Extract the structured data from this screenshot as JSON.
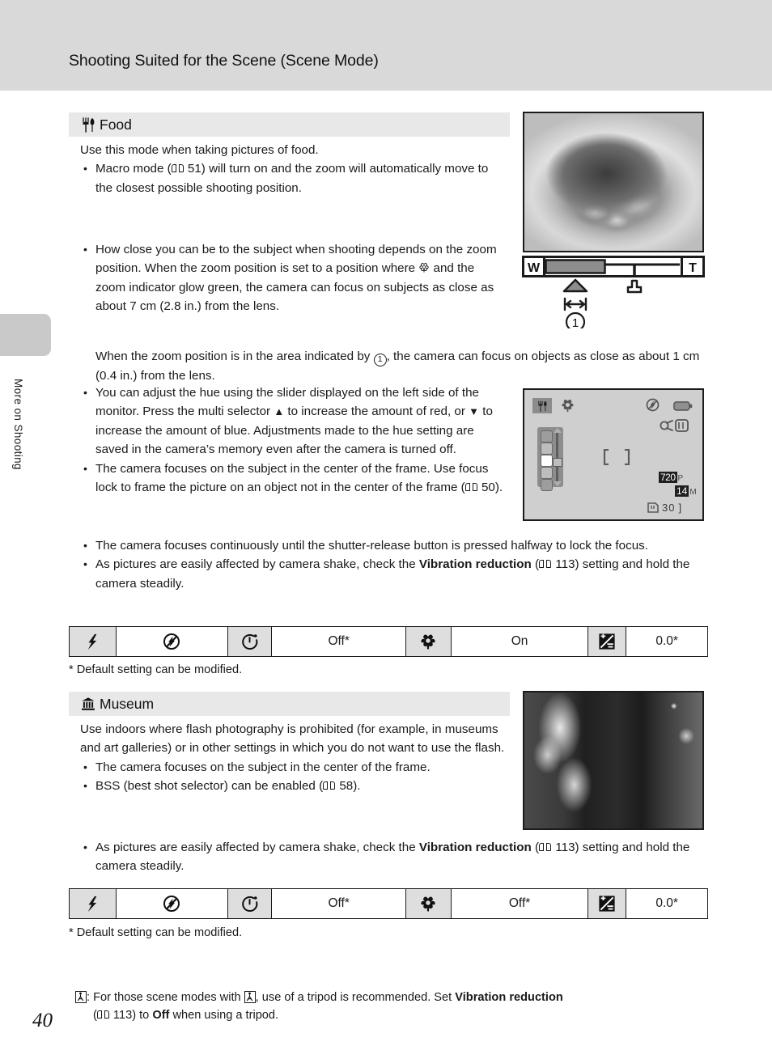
{
  "header": {
    "title": "Shooting Suited for the Scene (Scene Mode)"
  },
  "side_tab": {
    "label": "More on Shooting"
  },
  "page_number": "40",
  "sections": [
    {
      "id": "food",
      "icon": "cutlery-icon",
      "title": "Food",
      "intro": "Use this mode when taking pictures of food.",
      "bullets": [
        {
          "parts": [
            {
              "t": "text",
              "v": "Macro mode ("
            },
            {
              "t": "book",
              "v": ""
            },
            {
              "t": "text",
              "v": " 51) will turn on and the zoom will automatically move to the closest possible shooting position."
            }
          ]
        },
        {
          "parts": [
            {
              "t": "text",
              "v": "How close you can be to the subject when shooting depends on the zoom position. When the zoom position is set to a position where "
            },
            {
              "t": "macro",
              "v": ""
            },
            {
              "t": "text",
              "v": " and the zoom indicator glow green, the camera can focus on subjects as close as about 7 cm (2.8 in.) from the lens."
            }
          ],
          "continuation": [
            {
              "t": "text",
              "v": "When the zoom position is in the area indicated by "
            },
            {
              "t": "circ1",
              "v": "1"
            },
            {
              "t": "text",
              "v": ", the camera can focus on objects as close as about 1 cm (0.4 in.) from the lens."
            }
          ]
        },
        {
          "parts": [
            {
              "t": "text",
              "v": "You can adjust the hue using the slider displayed on the left side of the monitor. Press the multi selector "
            },
            {
              "t": "arrow-up",
              "v": "▲"
            },
            {
              "t": "text",
              "v": " to increase the amount of red, or "
            },
            {
              "t": "arrow-down",
              "v": "▼"
            },
            {
              "t": "text",
              "v": " to increase the amount of blue. Adjustments made to the hue setting are saved in the camera’s memory even after the camera is turned off."
            }
          ]
        },
        {
          "parts": [
            {
              "t": "text",
              "v": "The camera focuses on the subject in the center of the frame. Use focus lock to frame the picture on an object not in the center of the frame ("
            },
            {
              "t": "book",
              "v": ""
            },
            {
              "t": "text",
              "v": " 50)."
            }
          ]
        },
        {
          "parts": [
            {
              "t": "text",
              "v": "The camera focuses continuously until the shutter-release button is pressed halfway to lock the focus."
            }
          ]
        },
        {
          "parts": [
            {
              "t": "text",
              "v": "As pictures are easily affected by camera shake, check the "
            },
            {
              "t": "bold",
              "v": "Vibration reduction"
            },
            {
              "t": "text",
              "v": " ("
            },
            {
              "t": "book",
              "v": ""
            },
            {
              "t": "text",
              "v": " 113) setting and hold the camera steadily."
            }
          ]
        }
      ],
      "settings_row": [
        {
          "kind": "icon",
          "name": "flash-icon",
          "label": ""
        },
        {
          "kind": "value",
          "name": "flash-mode-value",
          "label": "flash-off-icon"
        },
        {
          "kind": "icon",
          "name": "self-timer-icon",
          "label": ""
        },
        {
          "kind": "value",
          "name": "self-timer-value",
          "label": "Off*"
        },
        {
          "kind": "icon",
          "name": "macro-mode-icon",
          "label": ""
        },
        {
          "kind": "value",
          "name": "macro-mode-value",
          "label": "On"
        },
        {
          "kind": "icon",
          "name": "exposure-compensation-icon",
          "label": ""
        },
        {
          "kind": "value",
          "name": "exposure-compensation-value",
          "label": "0.0*"
        }
      ],
      "footnote": "*  Default setting can be modified."
    },
    {
      "id": "museum",
      "icon": "museum-icon",
      "title": "Museum",
      "intro": "Use indoors where flash photography is prohibited (for example, in museums and art galleries) or in other settings in which you do not want to use the flash.",
      "bullets": [
        {
          "parts": [
            {
              "t": "text",
              "v": "The camera focuses on the subject in the center of the frame."
            }
          ]
        },
        {
          "parts": [
            {
              "t": "text",
              "v": "BSS (best shot selector) can be enabled ("
            },
            {
              "t": "book",
              "v": ""
            },
            {
              "t": "text",
              "v": " 58)."
            }
          ]
        },
        {
          "parts": [
            {
              "t": "text",
              "v": "As pictures are easily affected by camera shake, check the "
            },
            {
              "t": "bold",
              "v": "Vibration reduction"
            },
            {
              "t": "text",
              "v": " ("
            },
            {
              "t": "book",
              "v": ""
            },
            {
              "t": "text",
              "v": " 113) setting and hold the camera steadily."
            }
          ]
        }
      ],
      "settings_row": [
        {
          "kind": "icon",
          "name": "flash-icon",
          "label": ""
        },
        {
          "kind": "value",
          "name": "flash-mode-value",
          "label": "flash-off-icon"
        },
        {
          "kind": "icon",
          "name": "self-timer-icon",
          "label": ""
        },
        {
          "kind": "value",
          "name": "self-timer-value",
          "label": "Off*"
        },
        {
          "kind": "icon",
          "name": "macro-mode-icon",
          "label": ""
        },
        {
          "kind": "value",
          "name": "macro-mode-value",
          "label": "Off*"
        },
        {
          "kind": "icon",
          "name": "exposure-compensation-icon",
          "label": ""
        },
        {
          "kind": "value",
          "name": "exposure-compensation-value",
          "label": "0.0*"
        }
      ],
      "footnote": "*  Default setting can be modified."
    }
  ],
  "zoom_indicator": {
    "wide_label": "W",
    "tele_label": "T",
    "callout": "1"
  },
  "monitor": {
    "scene_badge": "cutlery-icon",
    "macro_badge": "macro-icon",
    "flash_off": "flash-off-icon",
    "battery": "battery-icon",
    "vr_icon": "vibration-reduction-icon",
    "af_frame": "[   ]",
    "movie_quality": "720",
    "movie_quality_suffix": "P",
    "image_size": "14",
    "image_size_suffix": "M",
    "frames_remaining": "30"
  },
  "bottom_note": {
    "prefix_icon": "tripod-icon",
    "line1_a": ":  For those scene modes with ",
    "line1_b": ", use of a tripod is recommended. Set ",
    "line1_bold": "Vibration reduction",
    "line2_a": "(",
    "line2_b": " 113) to ",
    "line2_bold": "Off",
    "line2_c": " when using a tripod."
  }
}
